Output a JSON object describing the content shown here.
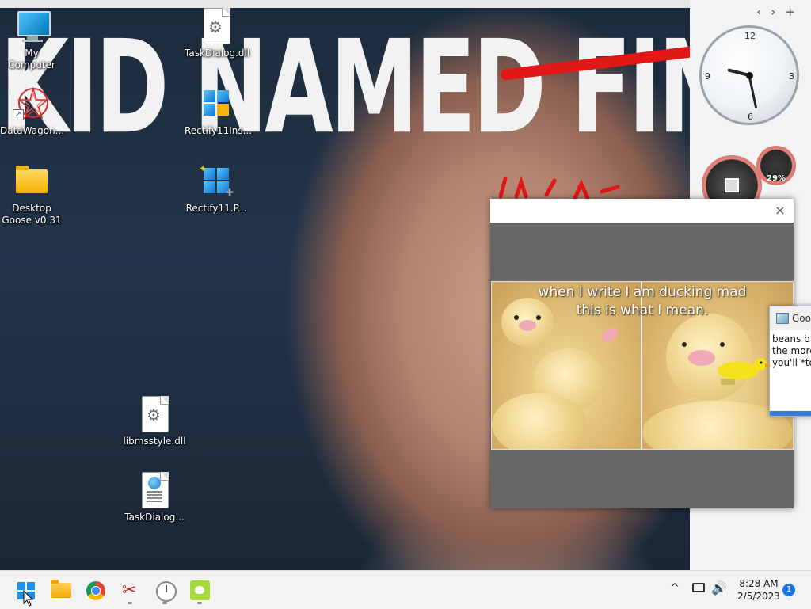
{
  "wallpaper": {
    "caption": "KID NAMED FINGER"
  },
  "desktop_icons": [
    {
      "label": "My Computer",
      "icon": "computer-icon"
    },
    {
      "label": "DataWagon...",
      "icon": "star-logo-icon"
    },
    {
      "label": "Desktop\nGoose v0.31",
      "icon": "folder-icon"
    },
    {
      "label": "TaskDialog.dll",
      "icon": "dll-file-icon"
    },
    {
      "label": "Rectify11Ins...",
      "icon": "rectify-installer-icon"
    },
    {
      "label": "Rectify11.P...",
      "icon": "rectify-icon"
    },
    {
      "label": "libmsstyle.dll",
      "icon": "dll-file-icon"
    },
    {
      "label": "TaskDialog...",
      "icon": "html-document-icon"
    }
  ],
  "gadgets": {
    "clock": {
      "numbers": [
        "12",
        "3",
        "6",
        "9"
      ],
      "time": "8:28"
    },
    "cpu_meter": {
      "percent_label": "29%",
      "percent_value": 29
    }
  },
  "sidebar": {
    "prev": "‹",
    "next": "›",
    "add": "+"
  },
  "image_viewer": {
    "close": "×",
    "meme_caption": "when I write I am ducking mad\nthis is what I mean."
  },
  "goose_note": {
    "title": "Goo",
    "body": "beans b\nthe more\nyou'll *to"
  },
  "taskbar": {
    "apps": [
      "start-button",
      "file-explorer",
      "chrome",
      "snipping-tool",
      "clock-app",
      "desktop-goose"
    ],
    "tray": {
      "time": "8:28 AM",
      "date": "2/5/2023",
      "notifications": "1"
    }
  },
  "colors": {
    "accent": "#1a73e8",
    "taskbar": "#f3f3f3",
    "strike": "#e01818"
  }
}
